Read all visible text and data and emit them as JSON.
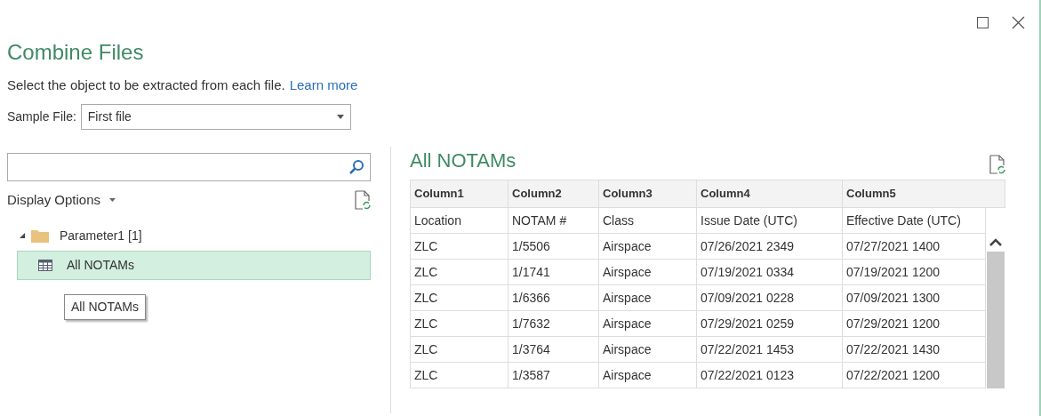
{
  "title": "Combine Files",
  "description": "Select the object to be extracted from each file.",
  "learn_more": "Learn more",
  "sample_file": {
    "label": "Sample File:",
    "value": "First file"
  },
  "display_options": "Display Options",
  "tree": [
    {
      "label": "Parameter1 [1]",
      "kind": "folder",
      "expanded": true,
      "selected": false,
      "children": [
        {
          "label": "All NOTAMs",
          "kind": "table",
          "selected": true
        }
      ]
    }
  ],
  "tooltip": "All NOTAMs",
  "preview": {
    "title": "All NOTAMs",
    "columns": [
      "Column1",
      "Column2",
      "Column3",
      "Column4",
      "Column5"
    ],
    "rows": [
      [
        "Location",
        "NOTAM #",
        "Class",
        "Issue Date (UTC)",
        "Effective Date (UTC)"
      ],
      [
        "ZLC",
        "1/5506",
        "Airspace",
        "07/26/2021 2349",
        "07/27/2021 1400"
      ],
      [
        "ZLC",
        "1/1741",
        "Airspace",
        "07/19/2021 0334",
        "07/19/2021 1200"
      ],
      [
        "ZLC",
        "1/6366",
        "Airspace",
        "07/09/2021 0228",
        "07/09/2021 1300"
      ],
      [
        "ZLC",
        "1/7632",
        "Airspace",
        "07/29/2021 0259",
        "07/29/2021 1200"
      ],
      [
        "ZLC",
        "1/3764",
        "Airspace",
        "07/22/2021 1453",
        "07/22/2021 1430"
      ],
      [
        "ZLC",
        "1/3587",
        "Airspace",
        "07/22/2021 0123",
        "07/22/2021 1200"
      ]
    ]
  }
}
